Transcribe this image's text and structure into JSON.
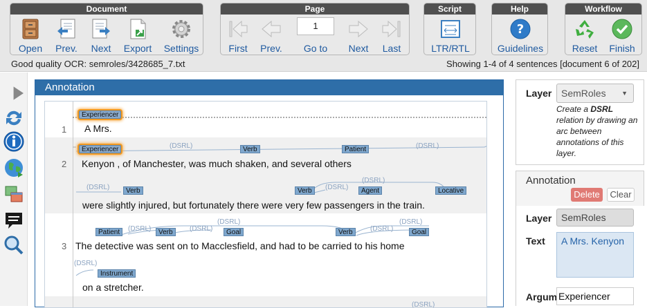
{
  "toolbar": {
    "document": {
      "title": "Document",
      "open": "Open",
      "prev": "Prev.",
      "next": "Next",
      "export": "Export",
      "settings": "Settings"
    },
    "page": {
      "title": "Page",
      "first": "First",
      "prev": "Prev.",
      "goto": "Go to",
      "next": "Next",
      "last": "Last",
      "current": "1"
    },
    "script": {
      "title": "Script",
      "ltr": "LTR/RTL"
    },
    "help": {
      "title": "Help",
      "guidelines": "Guidelines"
    },
    "workflow": {
      "title": "Workflow",
      "reset": "Reset",
      "finish": "Finish"
    }
  },
  "status": {
    "left": "Good quality OCR: semroles/3428685_7.txt",
    "right": "Showing 1-4 of 4 sentences [document 6 of 202]"
  },
  "annotation": {
    "title": "Annotation",
    "sentences": [
      {
        "num": "1",
        "text": "A Mrs."
      },
      {
        "num": "2",
        "text": "Kenyon   , of Manchester, was much shaken, and several others"
      },
      {
        "num": "",
        "text": "were slightly injured, but fortunately there were very few passengers in the train."
      },
      {
        "num": "3",
        "text": "The detective was sent on to Macclesfield, and had to be carried to his home"
      },
      {
        "num": "",
        "text": "on a stretcher."
      }
    ],
    "tags": {
      "experiencer": "Experiencer",
      "verb": "Verb",
      "patient": "Patient",
      "agent": "Agent",
      "locative": "Locative",
      "goal": "Goal",
      "instrument": "Instrument"
    },
    "relation": "(DSRL)"
  },
  "layer_panel": {
    "label": "Layer",
    "value": "SemRoles",
    "help": "Create a DSRL relation by drawing an arc between annotations of this layer.",
    "help_bold": "DSRL"
  },
  "detail_panel": {
    "title": "Annotation",
    "delete": "Delete",
    "clear": "Clear",
    "layer_label": "Layer",
    "layer_value": "SemRoles",
    "text_label": "Text",
    "text_value": "A Mrs. Kenyon",
    "argum_label": "Argum",
    "argum_value": "Experiencer"
  },
  "colors": {
    "accent": "#2e6ea8",
    "highlight": "#f39a21",
    "tag": "#7fa7cd",
    "delete": "#e07a74"
  }
}
